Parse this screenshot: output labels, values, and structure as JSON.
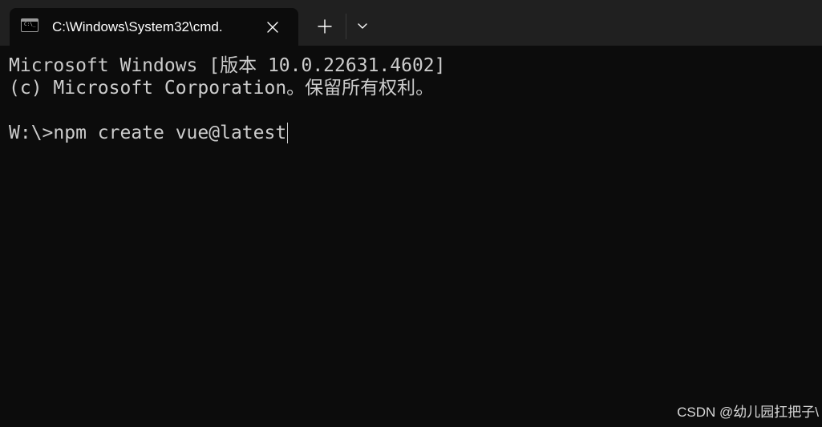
{
  "tab": {
    "title": "C:\\Windows\\System32\\cmd.",
    "icon": "cmd-terminal-icon",
    "icon_prompt": "C:\\_"
  },
  "titlebar": {
    "close_icon": "close-icon",
    "new_tab_icon": "plus-icon",
    "dropdown_icon": "chevron-down-icon"
  },
  "console": {
    "line1": "Microsoft Windows [版本 10.0.22631.4602]",
    "line2": "(c) Microsoft Corporation。保留所有权利。",
    "line3": "W:\\>npm create vue@latest"
  },
  "watermark": "CSDN @幼儿园扛把子\\",
  "colors": {
    "titlebar_bg": "#202020",
    "console_bg": "#0c0c0c",
    "text": "#cccccc"
  }
}
